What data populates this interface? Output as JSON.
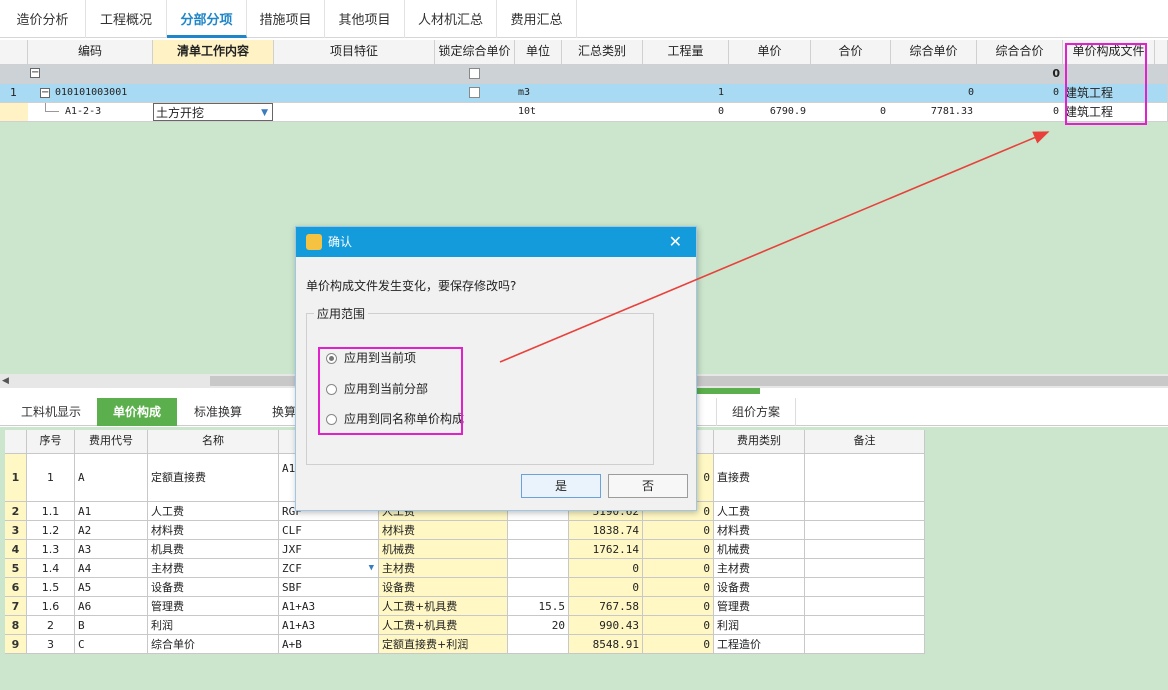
{
  "tabs": [
    "造价分析",
    "工程概况",
    "分部分项",
    "措施项目",
    "其他项目",
    "人材机汇总",
    "费用汇总"
  ],
  "active_tab": "分部分项",
  "top_grid": {
    "headers": [
      "编码",
      "清单工作内容",
      "项目特征",
      "锁定综合单价",
      "单位",
      "汇总类别",
      "工程量",
      "单价",
      "合价",
      "综合单价",
      "综合合价",
      "单价构成文件"
    ],
    "summary_row": {
      "zhhj": "0"
    },
    "row1": {
      "num": "1",
      "code": "010101003001",
      "unit": "m3",
      "qty": "1",
      "zhdj": "0",
      "zhhj": "0",
      "file": "建筑工程"
    },
    "row2": {
      "code": "A1-2-3",
      "content": "土方开挖",
      "unit": "10t",
      "qty": "0",
      "dj": "6790.9",
      "hj": "0",
      "zhdj": "7781.33",
      "zhhj": "0",
      "file": "建筑工程"
    }
  },
  "bottom_tabs": [
    "工料机显示",
    "单价构成",
    "标准换算",
    "换算",
    "组价方案"
  ],
  "bottom_grid": {
    "headers": [
      "序号",
      "费用代号",
      "名称",
      "费用类别",
      "备注"
    ],
    "rows": [
      {
        "rn": "1",
        "seq": "1",
        "code": "A",
        "name": "定额直接费",
        "base": "A1-…6",
        "base_desc": "",
        "rate": "",
        "amt": "",
        "y": "0",
        "type": "直接费"
      },
      {
        "rn": "2",
        "seq": "1.1",
        "code": "A1",
        "name": "人工费",
        "base": "RGF",
        "base_desc": "人工费",
        "rate": "",
        "amt": "5190.62",
        "y": "0",
        "type": "人工费"
      },
      {
        "rn": "3",
        "seq": "1.2",
        "code": "A2",
        "name": "材料费",
        "base": "CLF",
        "base_desc": "材料费",
        "rate": "",
        "amt": "1838.74",
        "y": "0",
        "type": "材料费"
      },
      {
        "rn": "4",
        "seq": "1.3",
        "code": "A3",
        "name": "机具费",
        "base": "JXF",
        "base_desc": "机械费",
        "rate": "",
        "amt": "1762.14",
        "y": "0",
        "type": "机械费"
      },
      {
        "rn": "5",
        "seq": "1.4",
        "code": "A4",
        "name": "主材费",
        "base": "ZCF",
        "base_desc": "主材费",
        "rate": "",
        "amt": "0",
        "y": "0",
        "type": "主材费"
      },
      {
        "rn": "6",
        "seq": "1.5",
        "code": "A5",
        "name": "设备费",
        "base": "SBF",
        "base_desc": "设备费",
        "rate": "",
        "amt": "0",
        "y": "0",
        "type": "设备费"
      },
      {
        "rn": "7",
        "seq": "1.6",
        "code": "A6",
        "name": "管理费",
        "base": "A1+A3",
        "base_desc": "人工费+机具费",
        "rate": "15.5",
        "amt": "767.58",
        "y": "0",
        "type": "管理费"
      },
      {
        "rn": "8",
        "seq": "2",
        "code": "B",
        "name": "利润",
        "base": "A1+A3",
        "base_desc": "人工费+机具费",
        "rate": "20",
        "amt": "990.43",
        "y": "0",
        "type": "利润"
      },
      {
        "rn": "9",
        "seq": "3",
        "code": "C",
        "name": "综合单价",
        "base": "A+B",
        "base_desc": "定额直接费+利润",
        "rate": "",
        "amt": "8548.91",
        "y": "0",
        "type": "工程造价"
      }
    ]
  },
  "dialog": {
    "title": "确认",
    "message": "单价构成文件发生变化，要保存修改吗?",
    "group_label": "应用范围",
    "options": [
      "应用到当前项",
      "应用到当前分部",
      "应用到同名称单价构成"
    ],
    "selected": 0,
    "yes": "是",
    "no": "否"
  },
  "colors": {
    "tab_active": "#1e86c8",
    "grid_bg": "#cbe6cc",
    "selected_row": "#a8daf3",
    "dialog_title": "#139bdc",
    "annotation": "#e021cc",
    "arrow": "#e8413b"
  }
}
